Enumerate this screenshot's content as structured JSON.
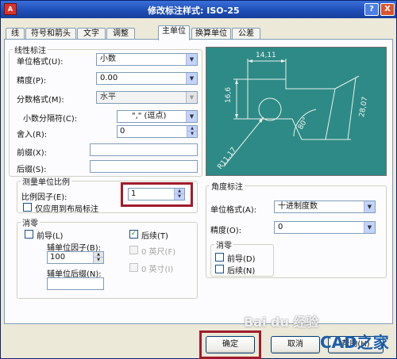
{
  "window": {
    "app_icon": "A",
    "title": "修改标注样式: ISO-25",
    "help_glyph": "?",
    "close_glyph": "X"
  },
  "tabs": [
    "线",
    "符号和箭头",
    "文字",
    "调整",
    "主单位",
    "换算单位",
    "公差"
  ],
  "linear": {
    "legend": "线性标注",
    "unit_format_label": "单位格式(U):",
    "unit_format_value": "小数",
    "precision_label": "精度(P):",
    "precision_value": "0.00",
    "fraction_format_label": "分数格式(M):",
    "fraction_format_value": "水平",
    "decimal_sep_label": "小数分隔符(C):",
    "decimal_sep_value": "\",\"  (逗点)",
    "round_off_label": "舍入(R):",
    "round_off_value": "0",
    "prefix_label": "前缀(X):",
    "prefix_value": "",
    "suffix_label": "后缀(S):",
    "suffix_value": ""
  },
  "scale": {
    "legend": "测量单位比例",
    "factor_label": "比例因子(E):",
    "factor_value": "1",
    "layout_only_label": "仅应用到布局标注"
  },
  "zero_linear": {
    "legend": "消零",
    "leading_label": "前导(L)",
    "sub_factor_label": "辅单位因子(B):",
    "sub_factor_value": "100",
    "sub_suffix_label": "辅单位后缀(N):",
    "sub_suffix_value": "",
    "trailing_label": "后续(T)",
    "feet_label": "0 英尺(F)",
    "inches_label": "0 英寸(I)"
  },
  "angular": {
    "legend": "角度标注",
    "unit_format_label": "单位格式(A):",
    "unit_format_value": "十进制度数",
    "precision_label": "精度(O):",
    "precision_value": "0"
  },
  "zero_angular": {
    "legend": "消零",
    "leading_label": "前导(D)",
    "trailing_label": "后续(N)"
  },
  "preview_labels": {
    "top": "14,11",
    "left": "16,6",
    "right": "28,07",
    "angle": "80°",
    "radius": "R11,17"
  },
  "buttons": {
    "ok": "确定",
    "cancel": "取消",
    "help": "帮助(H)"
  },
  "watermark": {
    "baidu": "Bai du 经验",
    "cad": "CAD之家"
  },
  "colors": {
    "title_bar": "#1f4fb8",
    "highlight": "#a01c2c",
    "preview_bg": "#2e8a86"
  }
}
